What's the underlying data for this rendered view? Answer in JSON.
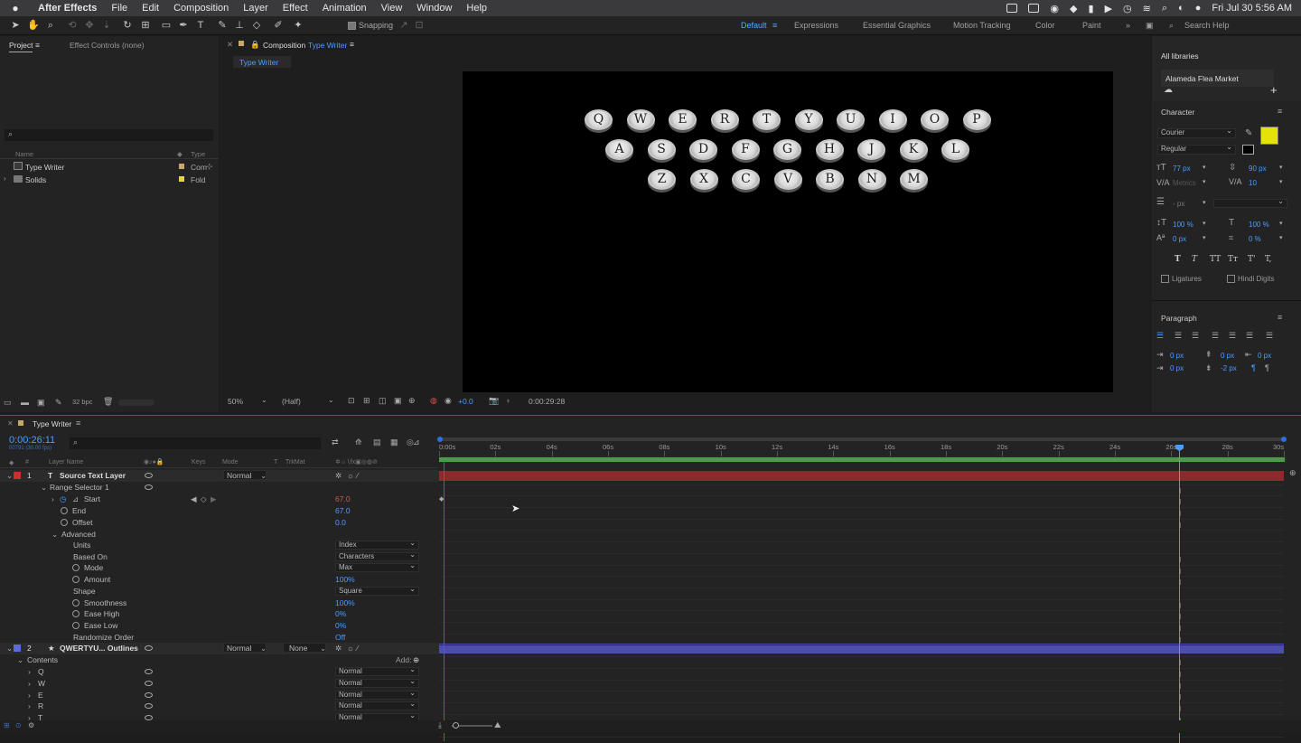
{
  "menubar": {
    "apple": "",
    "app": "After Effects",
    "items": [
      "File",
      "Edit",
      "Composition",
      "Layer",
      "Effect",
      "Animation",
      "View",
      "Window",
      "Help"
    ],
    "clock": "Fri Jul 30  5:56 AM"
  },
  "toolbar": {
    "snapping_label": "Snapping",
    "workspaces": [
      "Default",
      "Expressions",
      "Essential Graphics",
      "Motion Tracking",
      "Color",
      "Paint"
    ],
    "active_workspace": "Default",
    "search_placeholder": "Search Help"
  },
  "project_panel": {
    "tab_project": "Project",
    "tab_effect_controls": "Effect Controls (none)",
    "col_name": "Name",
    "col_type": "Type",
    "items": [
      {
        "name": "Type Writer",
        "type": "Com",
        "label_color": "#c8a86a"
      },
      {
        "name": "Solids",
        "type": "Fold",
        "label_color": "#e6d443"
      }
    ],
    "bpc": "32 bpc"
  },
  "composition_panel": {
    "tab_prefix": "Composition",
    "comp_name": "Type Writer",
    "sub_tab": "Type Writer",
    "zoom": "50%",
    "resolution": "(Half)",
    "exposure": "+0.0",
    "timecode": "0:00:29:28",
    "keyboard_rows": [
      [
        "Q",
        "W",
        "E",
        "R",
        "T",
        "Y",
        "U",
        "I",
        "O",
        "P"
      ],
      [
        "A",
        "S",
        "D",
        "F",
        "G",
        "H",
        "J",
        "K",
        "L"
      ],
      [
        "Z",
        "X",
        "C",
        "V",
        "B",
        "N",
        "M"
      ]
    ]
  },
  "right_panel": {
    "libraries_header": "All libraries",
    "library_item": "Alameda Flea Market",
    "character_title": "Character",
    "font": "Courier",
    "style": "Regular",
    "fill_color": "#e3e30a",
    "font_size": "77 px",
    "leading": "90 px",
    "kerning": "Metrics",
    "tracking": "10",
    "stroke_width": "- px",
    "vscale": "100 %",
    "hscale": "100 %",
    "baseline": "0 px",
    "tsume": "0 %",
    "format_buttons": [
      "T",
      "T",
      "TT",
      "Tт",
      "T'",
      "T,"
    ],
    "ligatures_label": "Ligatures",
    "hindi_label": "Hindi Digits",
    "paragraph_title": "Paragraph",
    "indent_left": "0 px",
    "space_before": "0 px",
    "indent_right": "0 px",
    "first_indent": "0 px",
    "space_after": "-2 px"
  },
  "timeline": {
    "tab": "Type Writer",
    "current_time": "0:00:26:11",
    "fps_note": "00791 (30.00 fps)",
    "col_headers": {
      "layer_name": "Layer Name",
      "keys": "Keys",
      "mode": "Mode",
      "t": "T",
      "trkmat": "TrkMat"
    },
    "ruler": [
      "0:00s",
      "02s",
      "04s",
      "06s",
      "08s",
      "10s",
      "12s",
      "14s",
      "16s",
      "18s",
      "20s",
      "22s",
      "24s",
      "26s",
      "28s",
      "30s"
    ],
    "layer1": {
      "num": "1",
      "name": "Source Text Layer",
      "mode": "Normal",
      "color": "#c9302c"
    },
    "range_selector": "Range Selector 1",
    "start_label": "Start",
    "start_value": "67.0",
    "end_label": "End",
    "end_value": "67.0",
    "offset_label": "Offset",
    "offset_value": "0.0",
    "advanced_label": "Advanced",
    "units_label": "Units",
    "units_value": "Index",
    "based_on_label": "Based On",
    "based_on_value": "Characters",
    "mode_label": "Mode",
    "mode_value": "Max",
    "amount_label": "Amount",
    "amount_value": "100%",
    "shape_label": "Shape",
    "shape_value": "Square",
    "smoothness_label": "Smoothness",
    "smoothness_value": "100%",
    "ease_high_label": "Ease High",
    "ease_high_value": "0%",
    "ease_low_label": "Ease Low",
    "ease_low_value": "0%",
    "randomize_label": "Randomize Order",
    "randomize_value": "Off",
    "layer2": {
      "num": "2",
      "name": "QWERTYU... Outlines",
      "mode": "Normal",
      "trkmat": "None",
      "color": "#5b6bd9"
    },
    "contents_label": "Contents",
    "add_label": "Add:",
    "content_items": [
      {
        "name": "Q",
        "mode": "Normal"
      },
      {
        "name": "W",
        "mode": "Normal"
      },
      {
        "name": "E",
        "mode": "Normal"
      },
      {
        "name": "R",
        "mode": "Normal"
      },
      {
        "name": "T",
        "mode": "Normal"
      }
    ]
  }
}
